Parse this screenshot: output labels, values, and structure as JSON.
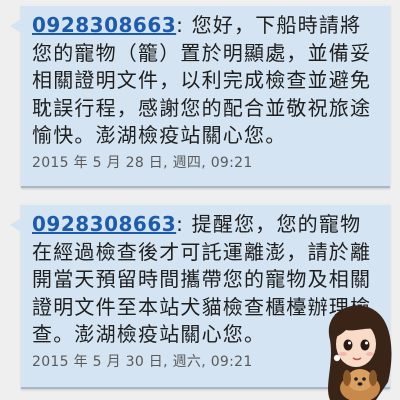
{
  "messages": [
    {
      "phone": "0928308663",
      "colon": ": ",
      "body": "您好，下船時請將您的寵物（籠）置於明顯處，並備妥相關證明文件，以利完成檢查並避免耽誤行程，感謝您的配合並敬祝旅途愉快。澎湖檢疫站關心您。",
      "timestamp": "2015 年 5 月 28 日, 週四, 09:21"
    },
    {
      "phone": "0928308663",
      "colon": ": ",
      "body": "提醒您，您的寵物在經過檢查後才可託運離澎，請於離開當天預留時間攜帶您的寵物及相關證明文件至本站犬貓檢查櫃檯辦理檢查。澎湖檢疫站關心您。",
      "timestamp": "2015 年 5 月 30 日, 週六, 09:21"
    }
  ],
  "colors": {
    "bubble": "#d4e4f2",
    "link": "#1e5ba8",
    "background": "#efefef"
  },
  "sticker": {
    "icon": "girl-with-puppy-sticker"
  }
}
